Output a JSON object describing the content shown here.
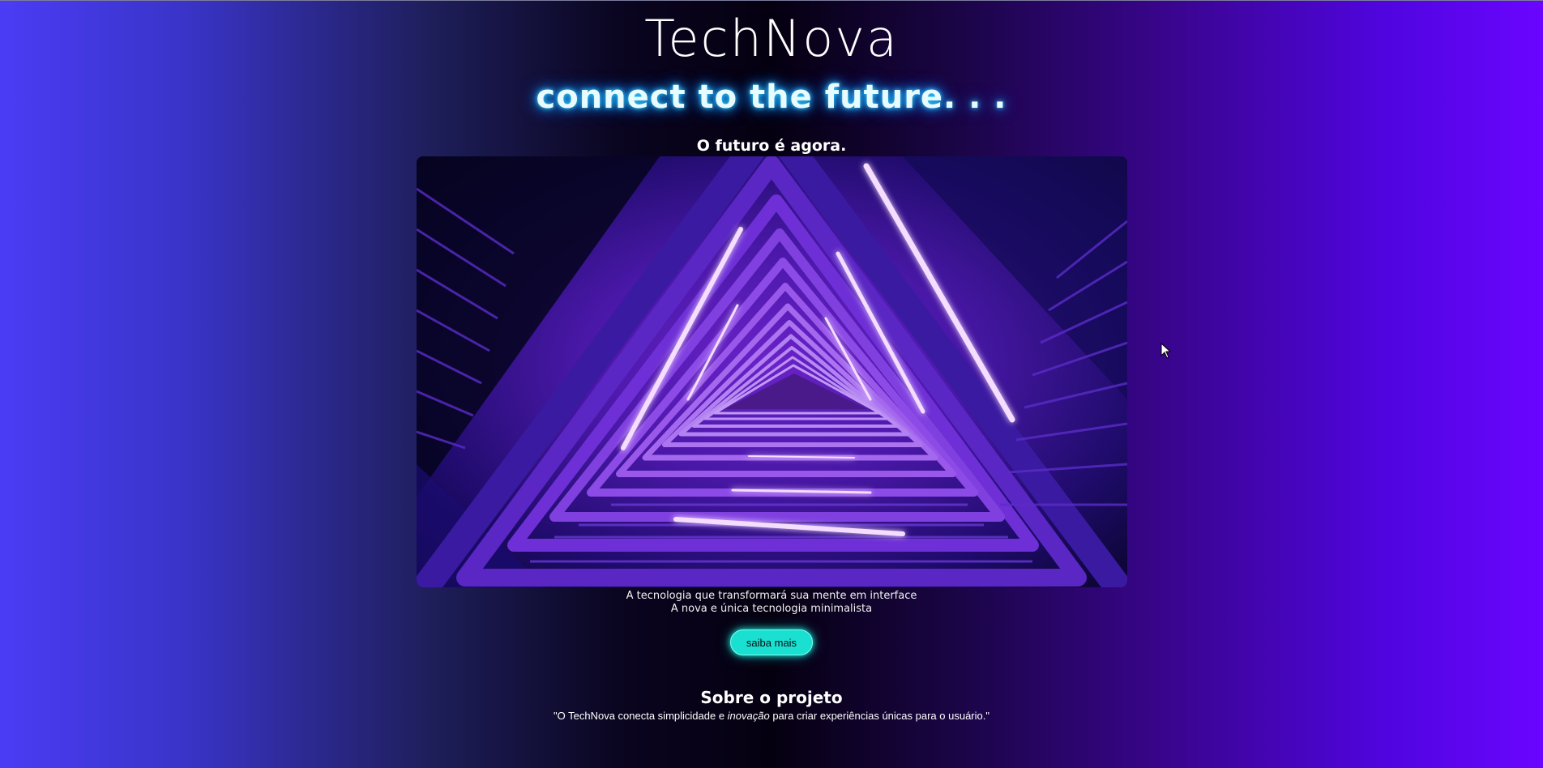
{
  "brand": {
    "name": "TechNova",
    "tagline": "connect to the future. . ."
  },
  "hero": {
    "heading": "O futuro é agora.",
    "image_subject": "neon-purple-triangular-staircase",
    "caption_line1": "A tecnologia que transformará sua mente em interface",
    "caption_line2": "A nova e única tecnologia minimalista",
    "cta_label": "saiba mais"
  },
  "about": {
    "title": "Sobre o projeto",
    "quote_before": "\"O TechNova conecta simplicidade e ",
    "quote_emphasis": "inovação",
    "quote_after": " para criar experiências únicas para o usuário.\""
  },
  "colors": {
    "gradient_left": "#4a3cf5",
    "gradient_center": "#050010",
    "gradient_right": "#6a05ff",
    "tagline_glow": "#3ad7ff",
    "cta_background": "#19e0d0"
  },
  "icons": {
    "cursor": "mouse-pointer-icon"
  }
}
